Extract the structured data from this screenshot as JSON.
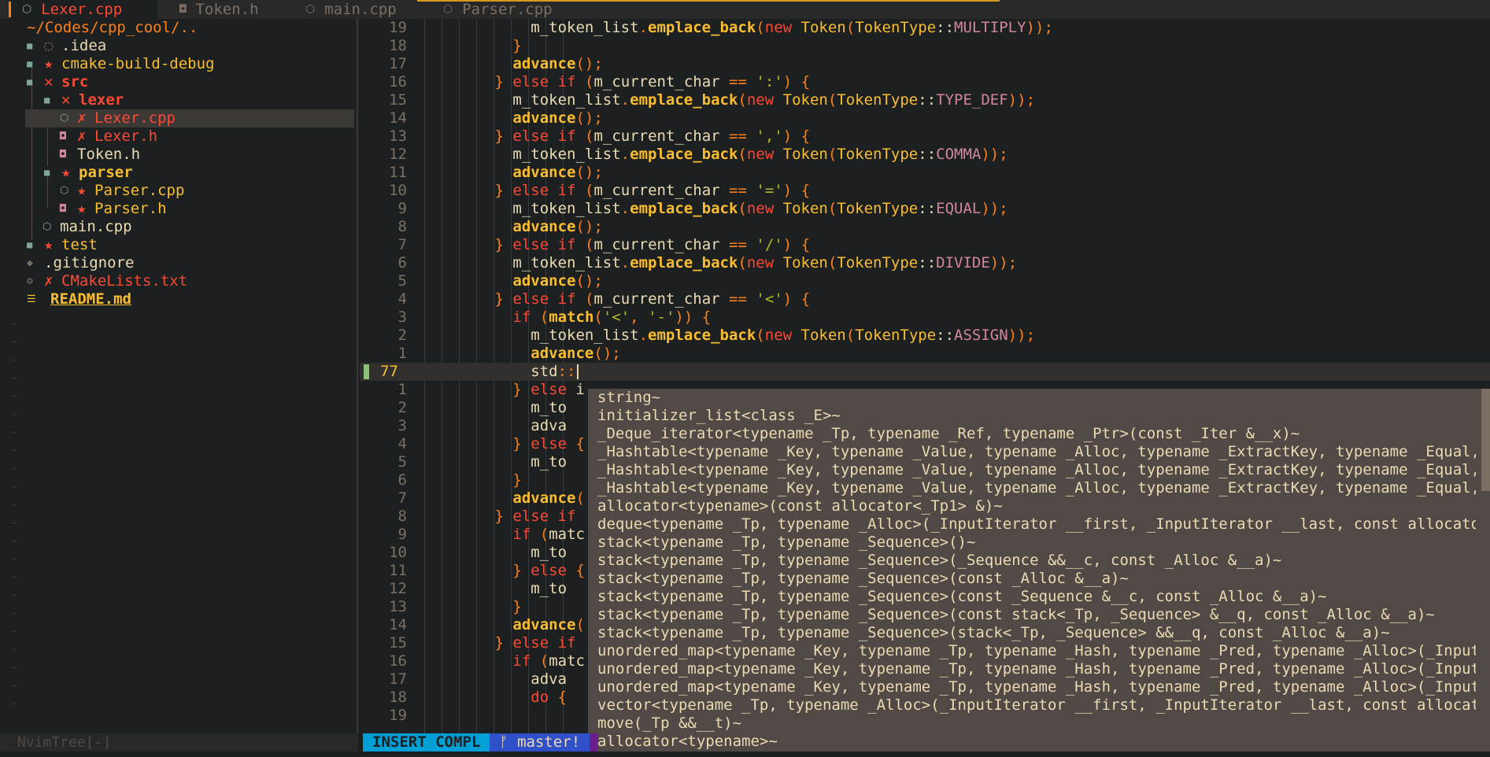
{
  "tabs": [
    {
      "label": "Lexer.cpp",
      "icon": "cpp-icon",
      "active": true
    },
    {
      "label": "Token.h",
      "icon": "header-icon",
      "active": false
    },
    {
      "label": "main.cpp",
      "icon": "cpp-icon",
      "active": false
    },
    {
      "label": "Parser.cpp",
      "icon": "cpp-icon",
      "active": false
    }
  ],
  "tree": {
    "root": "~/Codes/cpp_cool/..",
    "items": [
      {
        "label": ".idea",
        "icon": "folder-icon",
        "mark": "◌"
      },
      {
        "label": "cmake-build-debug",
        "icon": "folder-icon",
        "mark": "★"
      },
      {
        "label": "src",
        "icon": "folder-icon",
        "mark": "✕"
      },
      {
        "label": "lexer",
        "icon": "folder-icon",
        "mark": "✕"
      },
      {
        "label": "Lexer.cpp",
        "icon": "cpp-icon",
        "mark": "✗"
      },
      {
        "label": "Lexer.h",
        "icon": "header-icon",
        "mark": "✗"
      },
      {
        "label": "Token.h",
        "icon": "header-icon",
        "mark": ""
      },
      {
        "label": "parser",
        "icon": "folder-icon",
        "mark": "★"
      },
      {
        "label": "Parser.cpp",
        "icon": "cpp-icon",
        "mark": "★"
      },
      {
        "label": "Parser.h",
        "icon": "header-icon",
        "mark": "★"
      },
      {
        "label": "main.cpp",
        "icon": "cpp-icon",
        "mark": ""
      },
      {
        "label": "test",
        "icon": "folder-icon",
        "mark": "★"
      },
      {
        "label": ".gitignore",
        "icon": "git-icon",
        "mark": ""
      },
      {
        "label": "CMakeLists.txt",
        "icon": "gear-icon",
        "mark": "✗"
      },
      {
        "label": "README.md",
        "icon": "markdown-icon",
        "mark": ""
      }
    ],
    "status": "NvimTree[-]"
  },
  "editor": {
    "lines": [
      {
        "num": "19",
        "code": "            m_token_list.emplace_back(new Token(TokenType::MULTIPLY));"
      },
      {
        "num": "18",
        "code": "          }"
      },
      {
        "num": "17",
        "code": "          advance();"
      },
      {
        "num": "16",
        "code": "        } else if (m_current_char == ':') {"
      },
      {
        "num": "15",
        "code": "          m_token_list.emplace_back(new Token(TokenType::TYPE_DEF));"
      },
      {
        "num": "14",
        "code": "          advance();"
      },
      {
        "num": "13",
        "code": "        } else if (m_current_char == ',') {"
      },
      {
        "num": "12",
        "code": "          m_token_list.emplace_back(new Token(TokenType::COMMA));"
      },
      {
        "num": "11",
        "code": "          advance();"
      },
      {
        "num": "10",
        "code": "        } else if (m_current_char == '=') {"
      },
      {
        "num": "9",
        "code": "          m_token_list.emplace_back(new Token(TokenType::EQUAL));"
      },
      {
        "num": "8",
        "code": "          advance();"
      },
      {
        "num": "7",
        "code": "        } else if (m_current_char == '/') {"
      },
      {
        "num": "6",
        "code": "          m_token_list.emplace_back(new Token(TokenType::DIVIDE));"
      },
      {
        "num": "5",
        "code": "          advance();"
      },
      {
        "num": "4",
        "code": "        } else if (m_current_char == '<') {"
      },
      {
        "num": "3",
        "code": "          if (match('<', '-')) {"
      },
      {
        "num": "2",
        "code": "            m_token_list.emplace_back(new Token(TokenType::ASSIGN));"
      },
      {
        "num": "1",
        "code": "            advance();"
      },
      {
        "num": "77",
        "code": "            std::",
        "current": true
      },
      {
        "num": "1",
        "code": "          } else i"
      },
      {
        "num": "2",
        "code": "            m_to"
      },
      {
        "num": "3",
        "code": "            adva"
      },
      {
        "num": "4",
        "code": "          } else {"
      },
      {
        "num": "5",
        "code": "            m_to"
      },
      {
        "num": "6",
        "code": "          }"
      },
      {
        "num": "7",
        "code": "          advance("
      },
      {
        "num": "8",
        "code": "        } else if (m"
      },
      {
        "num": "9",
        "code": "          if (matc"
      },
      {
        "num": "10",
        "code": "            m_to"
      },
      {
        "num": "11",
        "code": "          } else {"
      },
      {
        "num": "12",
        "code": "            m_to"
      },
      {
        "num": "13",
        "code": "          }"
      },
      {
        "num": "14",
        "code": "          advance("
      },
      {
        "num": "15",
        "code": "        } else if (m"
      },
      {
        "num": "16",
        "code": "          if (matc"
      },
      {
        "num": "17",
        "code": "            adva"
      },
      {
        "num": "18",
        "code": "            do {"
      },
      {
        "num": "19",
        "code": ""
      }
    ]
  },
  "completion": {
    "items": [
      "string~",
      "initializer_list<class _E>~",
      "_Deque_iterator<typename _Tp, typename _Ref, typename _Ptr>(const _Iter &__x)~",
      "_Hashtable<typename _Key, typename _Value, typename _Alloc, typename _ExtractKey, typename _Equal, ty.",
      "_Hashtable<typename _Key, typename _Value, typename _Alloc, typename _ExtractKey, typename _Equal, ty.",
      "_Hashtable<typename _Key, typename _Value, typename _Alloc, typename _ExtractKey, typename _Equal, ty.",
      "allocator<typename>(const allocator<_Tp1> &)~",
      "deque<typename _Tp, typename _Alloc>(_InputIterator __first, _InputIterator __last, const allocator_t.",
      "stack<typename _Tp, typename _Sequence>()~",
      "stack<typename _Tp, typename _Sequence>(_Sequence &&__c, const _Alloc &__a)~",
      "stack<typename _Tp, typename _Sequence>(const _Alloc &__a)~",
      "stack<typename _Tp, typename _Sequence>(const _Sequence &__c, const _Alloc &__a)~",
      "stack<typename _Tp, typename _Sequence>(const stack<_Tp, _Sequence> &__q, const _Alloc &__a)~",
      "stack<typename _Tp, typename _Sequence>(stack<_Tp, _Sequence> &&__q, const _Alloc &__a)~",
      "unordered_map<typename _Key, typename _Tp, typename _Hash, typename _Pred, typename _Alloc>(_InputIte.",
      "unordered_map<typename _Key, typename _Tp, typename _Hash, typename _Pred, typename _Alloc>(_InputIte.",
      "unordered_map<typename _Key, typename _Tp, typename _Hash, typename _Pred, typename _Alloc>(_InputIte.",
      "vector<typename _Tp, typename _Alloc>(_InputIterator __first, _InputIterator __last, const allocator_.",
      "move(_Tp &&__t)~",
      "allocator<typename>~"
    ]
  },
  "statusline": {
    "mode": "INSERT COMPL",
    "branch": "ᚠ master!"
  },
  "colors": {
    "background": "#1d2021",
    "keyword": "#fb4934",
    "function": "#fabd2f",
    "enum": "#d3869b",
    "string": "#b8bb26",
    "mode_bg": "#00a0d6",
    "branch_bg": "#2f50c8"
  }
}
